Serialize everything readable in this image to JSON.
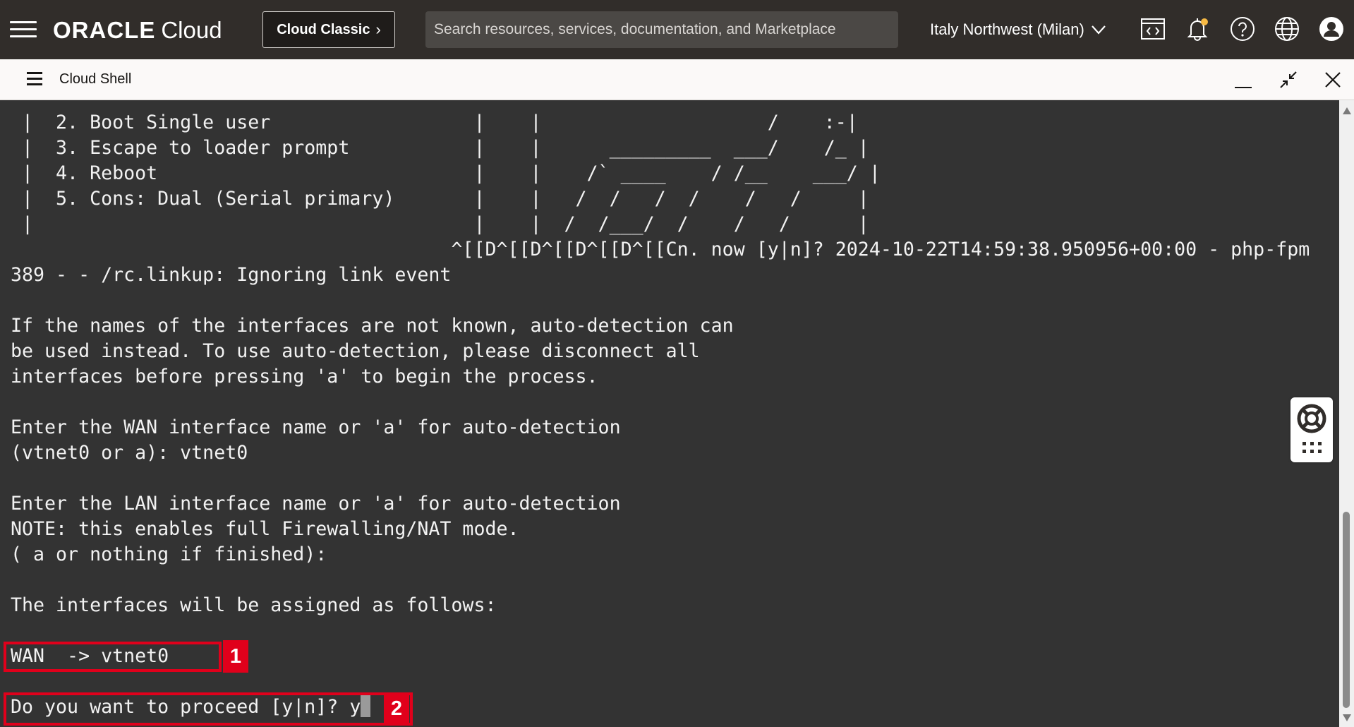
{
  "header": {
    "brand_oracle": "ORACLE",
    "brand_cloud": "Cloud",
    "classic_button": "Cloud Classic",
    "search_placeholder": "Search resources, services, documentation, and Marketplace",
    "region": "Italy Northwest (Milan)",
    "icons": [
      "menu-icon",
      "code-editor-icon",
      "bell-icon",
      "help-icon",
      "globe-icon",
      "profile-icon"
    ],
    "notification_dot_color": "#f6b944"
  },
  "shell": {
    "title": "Cloud Shell",
    "controls": [
      "minimize-icon",
      "restore-icon",
      "close-icon"
    ]
  },
  "terminal": {
    "background": "#333333",
    "lines": [
      " |  2. Boot Single user                  |    |                    /    :-|",
      " |  3. Escape to loader prompt           |    |      _________  ___/    /_ |",
      " |  4. Reboot                            |    |    /` ____    / /__    ___/ |",
      " |  5. Cons: Dual (Serial primary)       |    |   /  /   /  /    /   /     |",
      " |                                       |    |  /  /___/  /    /   /      |",
      "                                       ^[[D^[[D^[[D^[[D^[[Cn. now [y|n]? 2024-10-22T14:59:38.950956+00:00 - php-fpm",
      "389 - - /rc.linkup: Ignoring link event",
      "",
      "If the names of the interfaces are not known, auto-detection can",
      "be used instead. To use auto-detection, please disconnect all",
      "interfaces before pressing 'a' to begin the process.",
      "",
      "Enter the WAN interface name or 'a' for auto-detection",
      "(vtnet0 or a): vtnet0",
      "",
      "Enter the LAN interface name or 'a' for auto-detection",
      "NOTE: this enables full Firewalling/NAT mode.",
      "( a or nothing if finished):",
      "",
      "The interfaces will be assigned as follows:",
      "",
      "WAN  -> vtnet0",
      "",
      "Do you want to proceed [y|n]? y"
    ]
  },
  "annotations": [
    {
      "number": "1",
      "target": "WAN  -> vtnet0"
    },
    {
      "number": "2",
      "target": "Do you want to proceed [y|n]? y"
    }
  ],
  "annotation_color": "#e0001b"
}
